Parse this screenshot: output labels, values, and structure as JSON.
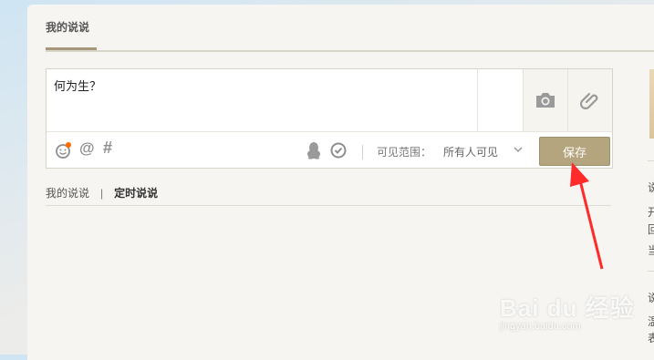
{
  "tabs": {
    "active_label": "我的说说"
  },
  "composer": {
    "text": "何为生？",
    "scope_label": "可见范围：",
    "scope_value": "所有人可见",
    "save_label": "保存"
  },
  "subtabs": {
    "mine": "我的说说",
    "separator": "|",
    "scheduled": "定时说说"
  },
  "sidebar": {
    "chars": [
      "说",
      "开",
      "回",
      "当",
      "说",
      "温",
      "表"
    ]
  },
  "watermark": {
    "logo": "Bai du 经验",
    "url": "jingyan.baidu.com"
  },
  "colors": {
    "accent": "#b5a57f",
    "arrow": "#ff2b2b",
    "badge": "#ff6a00"
  }
}
